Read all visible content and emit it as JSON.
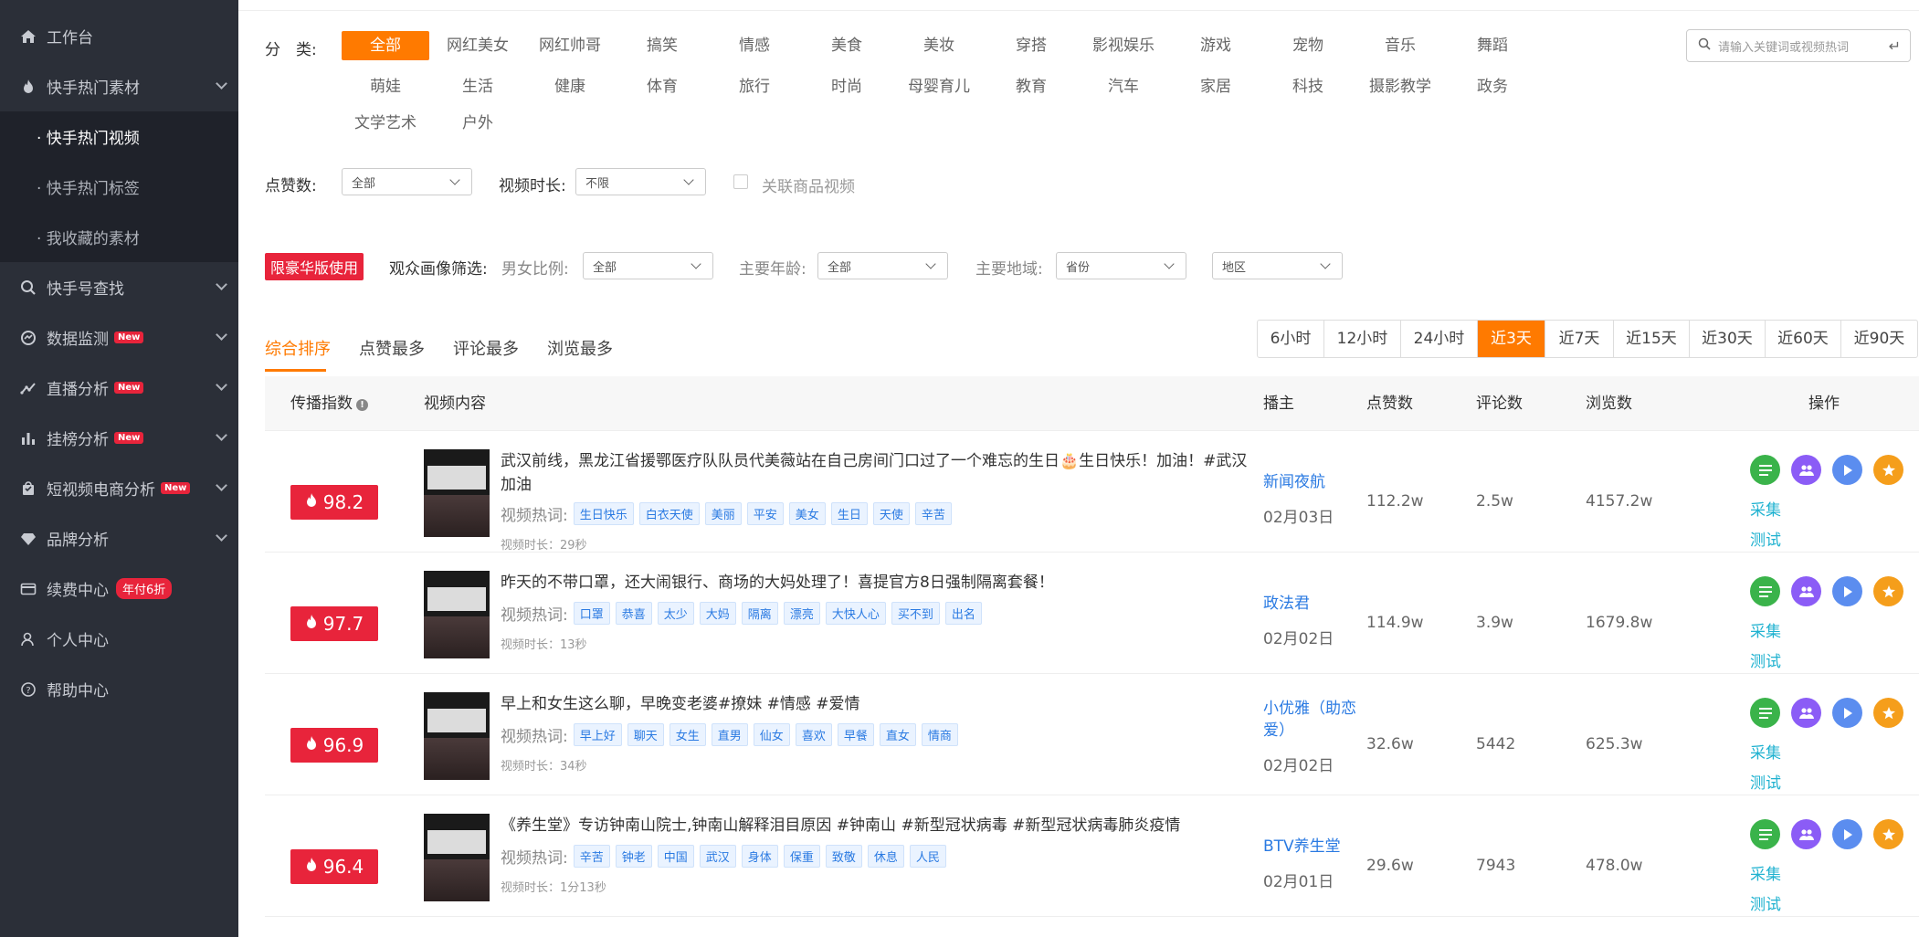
{
  "sidebar": {
    "items": [
      {
        "label": "工作台",
        "icon": "home-icon"
      },
      {
        "label": "快手热门素材",
        "icon": "fire-icon"
      },
      {
        "label": "快手号查找",
        "icon": "search-icon"
      },
      {
        "label": "数据监测",
        "icon": "monitor-icon",
        "badge": "New"
      },
      {
        "label": "直播分析",
        "icon": "trend-icon",
        "badge": "New"
      },
      {
        "label": "挂榜分析",
        "icon": "bar-icon",
        "badge": "New"
      },
      {
        "label": "短视频电商分析",
        "icon": "bag-icon",
        "badge": "New"
      },
      {
        "label": "品牌分析",
        "icon": "diamond-icon"
      },
      {
        "label": "续费中心",
        "icon": "card-icon",
        "badge": "年付6折"
      },
      {
        "label": "个人中心",
        "icon": "user-icon"
      },
      {
        "label": "帮助中心",
        "icon": "help-icon"
      }
    ],
    "subitems": [
      "· 快手热门视频",
      "· 快手热门标签",
      "· 我收藏的素材"
    ]
  },
  "filters": {
    "category_label": "分　类:",
    "categories_row1": [
      "全部",
      "网红美女",
      "网红帅哥",
      "搞笑",
      "情感",
      "美食",
      "美妆",
      "穿搭",
      "影视娱乐",
      "游戏",
      "宠物",
      "音乐",
      "舞蹈"
    ],
    "categories_row2": [
      "萌娃",
      "生活",
      "健康",
      "体育",
      "旅行",
      "时尚",
      "母婴育儿",
      "教育",
      "汽车",
      "家居",
      "科技",
      "摄影教学",
      "政务"
    ],
    "categories_row3": [
      "文学艺术",
      "户外"
    ],
    "search_placeholder": "请输入关键词或视频热词",
    "likes_label": "点赞数:",
    "likes_value": "全部",
    "duration_label": "视频时长:",
    "duration_value": "不限",
    "related_goods": "关联商品视频",
    "vip_badge": "限豪华版使用",
    "audience_label": "观众画像筛选:",
    "gender_label": "男女比例:",
    "gender_value": "全部",
    "age_label": "主要年龄:",
    "age_value": "全部",
    "region_label": "主要地域:",
    "province_value": "省份",
    "area_value": "地区"
  },
  "sort_tabs": [
    "综合排序",
    "点赞最多",
    "评论最多",
    "浏览最多"
  ],
  "time_ranges": [
    "6小时",
    "12小时",
    "24小时",
    "近3天",
    "近7天",
    "近15天",
    "近30天",
    "近60天",
    "近90天"
  ],
  "table": {
    "headers": {
      "index": "传播指数",
      "content": "视频内容",
      "host": "播主",
      "likes": "点赞数",
      "comments": "评论数",
      "views": "浏览数",
      "ops": "操作"
    },
    "hot_label": "视频热词:",
    "op_collect": "采集",
    "op_test": "测试",
    "rows": [
      {
        "score": "98.2",
        "title": "武汉前线，黑龙江省援鄂医疗队队员代美薇站在自己房间门口过了一个难忘的生日🎂生日快乐！加油！#武汉加油",
        "tags": [
          "生日快乐",
          "白衣天使",
          "美丽",
          "平安",
          "美女",
          "生日",
          "天使",
          "辛苦"
        ],
        "duration": "视频时长：29秒",
        "host": "新闻夜航",
        "date": "02月03日",
        "likes": "112.2w",
        "comments": "2.5w",
        "views": "4157.2w"
      },
      {
        "score": "97.7",
        "title": "昨天的不带口罩，还大闹银行、商场的大妈处理了！喜提官方8日强制隔离套餐！",
        "tags": [
          "口罩",
          "恭喜",
          "太少",
          "大妈",
          "隔离",
          "漂亮",
          "大快人心",
          "买不到",
          "出名"
        ],
        "duration": "视频时长：13秒",
        "host": "政法君",
        "date": "02月02日",
        "likes": "114.9w",
        "comments": "3.9w",
        "views": "1679.8w"
      },
      {
        "score": "96.9",
        "title": "早上和女生这么聊，早晚变老婆#撩妹 #情感 #爱情",
        "tags": [
          "早上好",
          "聊天",
          "女生",
          "直男",
          "仙女",
          "喜欢",
          "早餐",
          "直女",
          "情商"
        ],
        "duration": "视频时长：34秒",
        "host": "小优雅（助恋爱）",
        "date": "02月02日",
        "likes": "32.6w",
        "comments": "5442",
        "views": "625.3w"
      },
      {
        "score": "96.4",
        "title": "《养生堂》专访钟南山院士,钟南山解释泪目原因 #钟南山 #新型冠状病毒 #新型冠状病毒肺炎疫情",
        "tags": [
          "辛苦",
          "钟老",
          "中国",
          "武汉",
          "身体",
          "保重",
          "致敬",
          "休息",
          "人民"
        ],
        "duration": "视频时长：1分13秒",
        "host": "BTV养生堂",
        "date": "02月01日",
        "likes": "29.6w",
        "comments": "7943",
        "views": "478.0w"
      }
    ]
  },
  "colors": {
    "sidebar_bg": "#2b2f38",
    "accent": "#ff7a00",
    "score_red": "#e8243b",
    "link_blue": "#2a7ae2",
    "teal": "#20b2d0"
  }
}
